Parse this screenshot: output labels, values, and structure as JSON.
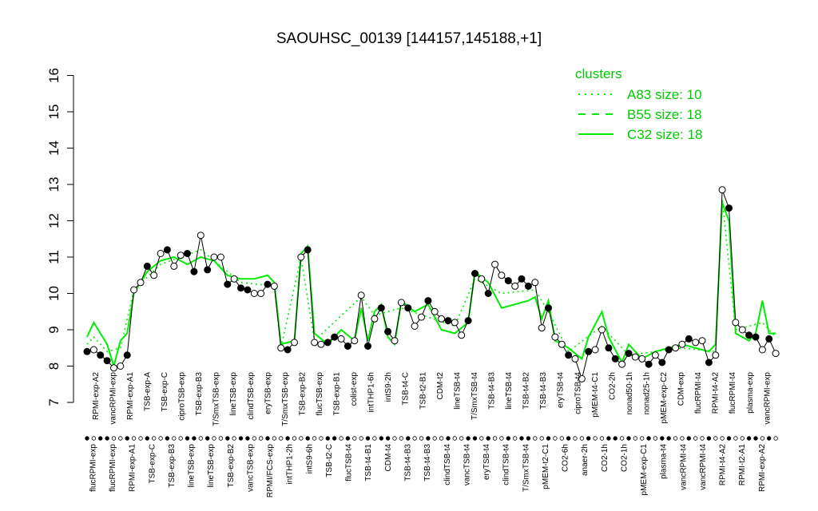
{
  "chart_data": {
    "type": "line",
    "title": "SAOUHSC_00139 [144157,145188,+1]",
    "xlabel": "",
    "ylabel": "",
    "ylim": [
      7,
      16
    ],
    "yticks": [
      "7",
      "8",
      "9",
      "10",
      "11",
      "12",
      "13",
      "14",
      "15",
      "16"
    ],
    "grid": false,
    "legend": {
      "title": "clusters",
      "placement": "top-right",
      "entries": [
        {
          "label": "A83 size: 10",
          "style": "dotted"
        },
        {
          "label": "B55 size: 18",
          "style": "dashed"
        },
        {
          "label": "C32 size: 18",
          "style": "solid"
        }
      ]
    },
    "colors": {
      "cluster": "#00ee00",
      "legend_text": "#00cc00",
      "series": "#000000",
      "point_fill": "#ffffff"
    },
    "x_labels_top": [
      "RPMI-exp-A2",
      "vancRPMI-exp",
      "RPMI-exp-A1",
      "TSB-exp-A",
      "TSB-exp-C",
      "ciproTSB-exp",
      "TSB-exp-B3",
      "T/SmxTSB-exp",
      "lineTSB-exp",
      "clindTSB-exp",
      "eryTSB-exp",
      "T/SmxTSB-exp",
      "TSB-exp-B2",
      "flucTSB-exp",
      "TSB-exp-B1",
      "colist-exp",
      "intTHP1-6h",
      "intS9-2h",
      "TSB-t4-C",
      "TSB-t2-B1",
      "CDM-t2",
      "lineTSB-t4",
      "T/SmxTSB-t4",
      "TSB-t4-B3",
      "lineTSB-t4",
      "TSB-t4-B2",
      "TSB-t4-B3",
      "eryTSB-t4",
      "ciproTSB-t4",
      "pMEM-t4-C1",
      "CO2-2h",
      "nonad50-1h",
      "nonad25-1h",
      "pMEM-exp-C2",
      "CDM-exp",
      "flucRPMI-t4",
      "RPMI-t4-A2",
      "flucRPMI-t4",
      "plasma-exp",
      "vancRPMI-exp"
    ],
    "x_labels_bottom": [
      "flucRPMI-exp",
      "flucRPMI-exp",
      "RPMI-exp-A1",
      "TSB-exp-C",
      "TSB-exp-B3",
      "lineTSB-exp",
      "lineTSB-exp",
      "TSB-exp-B2",
      "vancTSB-exp",
      "RPMI/FCS-exp",
      "intTHP1-2h",
      "intS9-6h",
      "TSB-t2-C",
      "flucTSB-t4",
      "TSB-t4-B1",
      "CDM-t4",
      "TSB-t4-B3",
      "TSB-t4-B3",
      "clindTSB-t4",
      "vancTSB-t4",
      "eryTSB-t4",
      "clindTSB-t4",
      "T/SmxTSB-t4",
      "pMEM-t2-C1",
      "CO2-6h",
      "anaer-2h",
      "CO2-1h",
      "CO2-1h",
      "pMEM-exp-C1",
      "plasma-t4",
      "vancRPMI-t4",
      "vancRPMI-t4",
      "RPMI-t4-A2",
      "RPMI-t2-A1",
      "RPMI-exp-A2"
    ],
    "overlap_label": "vancRPMI-t4 RPMI-t4-A2 / TSB-exp-B2",
    "points": [
      {
        "x": 1,
        "y": 8.4
      },
      {
        "x": 2,
        "y": 8.45
      },
      {
        "x": 3,
        "y": 8.3
      },
      {
        "x": 4,
        "y": 8.15
      },
      {
        "x": 5,
        "y": 7.95
      },
      {
        "x": 6,
        "y": 8.0
      },
      {
        "x": 7,
        "y": 8.3
      },
      {
        "x": 8,
        "y": 10.1
      },
      {
        "x": 9,
        "y": 10.3
      },
      {
        "x": 10,
        "y": 10.75
      },
      {
        "x": 11,
        "y": 10.5
      },
      {
        "x": 12,
        "y": 11.1
      },
      {
        "x": 13,
        "y": 11.2
      },
      {
        "x": 14,
        "y": 10.75
      },
      {
        "x": 15,
        "y": 11.05
      },
      {
        "x": 16,
        "y": 11.1
      },
      {
        "x": 17,
        "y": 10.6
      },
      {
        "x": 18,
        "y": 11.6
      },
      {
        "x": 19,
        "y": 10.65
      },
      {
        "x": 20,
        "y": 11.0
      },
      {
        "x": 21,
        "y": 11.0
      },
      {
        "x": 22,
        "y": 10.25
      },
      {
        "x": 23,
        "y": 10.4
      },
      {
        "x": 24,
        "y": 10.15
      },
      {
        "x": 25,
        "y": 10.1
      },
      {
        "x": 26,
        "y": 10.0
      },
      {
        "x": 27,
        "y": 10.0
      },
      {
        "x": 28,
        "y": 10.25
      },
      {
        "x": 29,
        "y": 10.2
      },
      {
        "x": 30,
        "y": 8.5
      },
      {
        "x": 31,
        "y": 8.45
      },
      {
        "x": 32,
        "y": 8.65
      },
      {
        "x": 33,
        "y": 11.0
      },
      {
        "x": 34,
        "y": 11.2
      },
      {
        "x": 35,
        "y": 8.65
      },
      {
        "x": 36,
        "y": 8.6
      },
      {
        "x": 37,
        "y": 8.65
      },
      {
        "x": 38,
        "y": 8.8
      },
      {
        "x": 39,
        "y": 8.75
      },
      {
        "x": 40,
        "y": 8.55
      },
      {
        "x": 41,
        "y": 8.7
      },
      {
        "x": 42,
        "y": 9.95
      },
      {
        "x": 43,
        "y": 8.55
      },
      {
        "x": 44,
        "y": 9.3
      },
      {
        "x": 45,
        "y": 9.6
      },
      {
        "x": 46,
        "y": 8.95
      },
      {
        "x": 47,
        "y": 8.7
      },
      {
        "x": 48,
        "y": 9.75
      },
      {
        "x": 49,
        "y": 9.6
      },
      {
        "x": 50,
        "y": 9.1
      },
      {
        "x": 51,
        "y": 9.35
      },
      {
        "x": 52,
        "y": 9.8
      },
      {
        "x": 53,
        "y": 9.5
      },
      {
        "x": 54,
        "y": 9.3
      },
      {
        "x": 55,
        "y": 9.25
      },
      {
        "x": 56,
        "y": 9.2
      },
      {
        "x": 57,
        "y": 8.85
      },
      {
        "x": 58,
        "y": 9.25
      },
      {
        "x": 59,
        "y": 10.55
      },
      {
        "x": 60,
        "y": 10.4
      },
      {
        "x": 61,
        "y": 10.0
      },
      {
        "x": 62,
        "y": 10.8
      },
      {
        "x": 63,
        "y": 10.5
      },
      {
        "x": 64,
        "y": 10.35
      },
      {
        "x": 65,
        "y": 10.2
      },
      {
        "x": 66,
        "y": 10.4
      },
      {
        "x": 67,
        "y": 10.2
      },
      {
        "x": 68,
        "y": 10.3
      },
      {
        "x": 69,
        "y": 9.05
      },
      {
        "x": 70,
        "y": 9.6
      },
      {
        "x": 71,
        "y": 8.8
      },
      {
        "x": 72,
        "y": 8.6
      },
      {
        "x": 73,
        "y": 8.3
      },
      {
        "x": 74,
        "y": 8.2
      },
      {
        "x": 75,
        "y": 7.65
      },
      {
        "x": 76,
        "y": 8.4
      },
      {
        "x": 77,
        "y": 8.45
      },
      {
        "x": 78,
        "y": 9.0
      },
      {
        "x": 79,
        "y": 8.5
      },
      {
        "x": 80,
        "y": 8.2
      },
      {
        "x": 81,
        "y": 8.05
      },
      {
        "x": 82,
        "y": 8.35
      },
      {
        "x": 83,
        "y": 8.25
      },
      {
        "x": 84,
        "y": 8.2
      },
      {
        "x": 85,
        "y": 8.05
      },
      {
        "x": 86,
        "y": 8.3
      },
      {
        "x": 87,
        "y": 8.1
      },
      {
        "x": 88,
        "y": 8.45
      },
      {
        "x": 89,
        "y": 8.5
      },
      {
        "x": 90,
        "y": 8.6
      },
      {
        "x": 91,
        "y": 8.75
      },
      {
        "x": 92,
        "y": 8.65
      },
      {
        "x": 93,
        "y": 8.7
      },
      {
        "x": 94,
        "y": 8.1
      },
      {
        "x": 95,
        "y": 8.3
      },
      {
        "x": 96,
        "y": 12.85
      },
      {
        "x": 97,
        "y": 12.35
      },
      {
        "x": 98,
        "y": 9.2
      },
      {
        "x": 99,
        "y": 9.0
      },
      {
        "x": 100,
        "y": 8.85
      },
      {
        "x": 101,
        "y": 8.8
      },
      {
        "x": 102,
        "y": 8.45
      },
      {
        "x": 103,
        "y": 8.75
      },
      {
        "x": 104,
        "y": 8.35
      }
    ],
    "cluster_line": [
      {
        "x": 1,
        "y": 8.8
      },
      {
        "x": 2,
        "y": 9.2
      },
      {
        "x": 4,
        "y": 8.6
      },
      {
        "x": 5,
        "y": 8.0
      },
      {
        "x": 6,
        "y": 8.7
      },
      {
        "x": 7,
        "y": 8.9
      },
      {
        "x": 8,
        "y": 10.0
      },
      {
        "x": 10,
        "y": 10.6
      },
      {
        "x": 12,
        "y": 10.9
      },
      {
        "x": 14,
        "y": 11.0
      },
      {
        "x": 16,
        "y": 10.8
      },
      {
        "x": 18,
        "y": 11.0
      },
      {
        "x": 20,
        "y": 10.9
      },
      {
        "x": 22,
        "y": 10.5
      },
      {
        "x": 24,
        "y": 10.4
      },
      {
        "x": 26,
        "y": 10.4
      },
      {
        "x": 28,
        "y": 10.5
      },
      {
        "x": 29,
        "y": 10.3
      },
      {
        "x": 30,
        "y": 8.6
      },
      {
        "x": 32,
        "y": 8.7
      },
      {
        "x": 33,
        "y": 11.1
      },
      {
        "x": 34,
        "y": 11.3
      },
      {
        "x": 35,
        "y": 8.9
      },
      {
        "x": 37,
        "y": 8.6
      },
      {
        "x": 39,
        "y": 9.0
      },
      {
        "x": 41,
        "y": 8.7
      },
      {
        "x": 42,
        "y": 9.6
      },
      {
        "x": 43,
        "y": 8.7
      },
      {
        "x": 44,
        "y": 9.5
      },
      {
        "x": 45,
        "y": 9.7
      },
      {
        "x": 46,
        "y": 8.8
      },
      {
        "x": 47,
        "y": 8.6
      },
      {
        "x": 48,
        "y": 9.8
      },
      {
        "x": 50,
        "y": 9.5
      },
      {
        "x": 52,
        "y": 9.7
      },
      {
        "x": 54,
        "y": 9.0
      },
      {
        "x": 56,
        "y": 8.9
      },
      {
        "x": 58,
        "y": 9.2
      },
      {
        "x": 59,
        "y": 10.6
      },
      {
        "x": 61,
        "y": 10.3
      },
      {
        "x": 63,
        "y": 9.6
      },
      {
        "x": 65,
        "y": 9.7
      },
      {
        "x": 67,
        "y": 9.8
      },
      {
        "x": 68,
        "y": 9.9
      },
      {
        "x": 69,
        "y": 9.3
      },
      {
        "x": 70,
        "y": 9.8
      },
      {
        "x": 71,
        "y": 8.7
      },
      {
        "x": 73,
        "y": 8.5
      },
      {
        "x": 75,
        "y": 8.2
      },
      {
        "x": 76,
        "y": 8.8
      },
      {
        "x": 78,
        "y": 9.5
      },
      {
        "x": 79,
        "y": 8.8
      },
      {
        "x": 81,
        "y": 8.1
      },
      {
        "x": 82,
        "y": 8.6
      },
      {
        "x": 84,
        "y": 8.2
      },
      {
        "x": 86,
        "y": 8.4
      },
      {
        "x": 88,
        "y": 8.5
      },
      {
        "x": 90,
        "y": 8.6
      },
      {
        "x": 92,
        "y": 8.5
      },
      {
        "x": 94,
        "y": 8.4
      },
      {
        "x": 95,
        "y": 8.6
      },
      {
        "x": 96,
        "y": 12.5
      },
      {
        "x": 97,
        "y": 12.0
      },
      {
        "x": 98,
        "y": 8.9
      },
      {
        "x": 100,
        "y": 8.7
      },
      {
        "x": 101,
        "y": 8.9
      },
      {
        "x": 102,
        "y": 9.8
      },
      {
        "x": 103,
        "y": 8.9
      },
      {
        "x": 104,
        "y": 8.9
      }
    ],
    "dotted_line": [
      {
        "x": 1,
        "y": 8.6
      },
      {
        "x": 2,
        "y": 8.8
      },
      {
        "x": 4,
        "y": 8.4
      },
      {
        "x": 6,
        "y": 8.5
      },
      {
        "x": 8,
        "y": 10.1
      },
      {
        "x": 12,
        "y": 10.8
      },
      {
        "x": 18,
        "y": 11.2
      },
      {
        "x": 24,
        "y": 10.3
      },
      {
        "x": 29,
        "y": 10.2
      },
      {
        "x": 30,
        "y": 8.5
      },
      {
        "x": 33,
        "y": 11.0
      },
      {
        "x": 35,
        "y": 8.7
      },
      {
        "x": 42,
        "y": 9.9
      },
      {
        "x": 44,
        "y": 9.4
      },
      {
        "x": 48,
        "y": 9.6
      },
      {
        "x": 56,
        "y": 9.1
      },
      {
        "x": 59,
        "y": 10.4
      },
      {
        "x": 63,
        "y": 10.0
      },
      {
        "x": 68,
        "y": 10.1
      },
      {
        "x": 70,
        "y": 9.5
      },
      {
        "x": 73,
        "y": 8.4
      },
      {
        "x": 78,
        "y": 9.1
      },
      {
        "x": 82,
        "y": 8.3
      },
      {
        "x": 90,
        "y": 8.5
      },
      {
        "x": 95,
        "y": 8.4
      },
      {
        "x": 96,
        "y": 12.6
      },
      {
        "x": 98,
        "y": 9.0
      },
      {
        "x": 102,
        "y": 9.2
      },
      {
        "x": 104,
        "y": 8.8
      }
    ]
  }
}
